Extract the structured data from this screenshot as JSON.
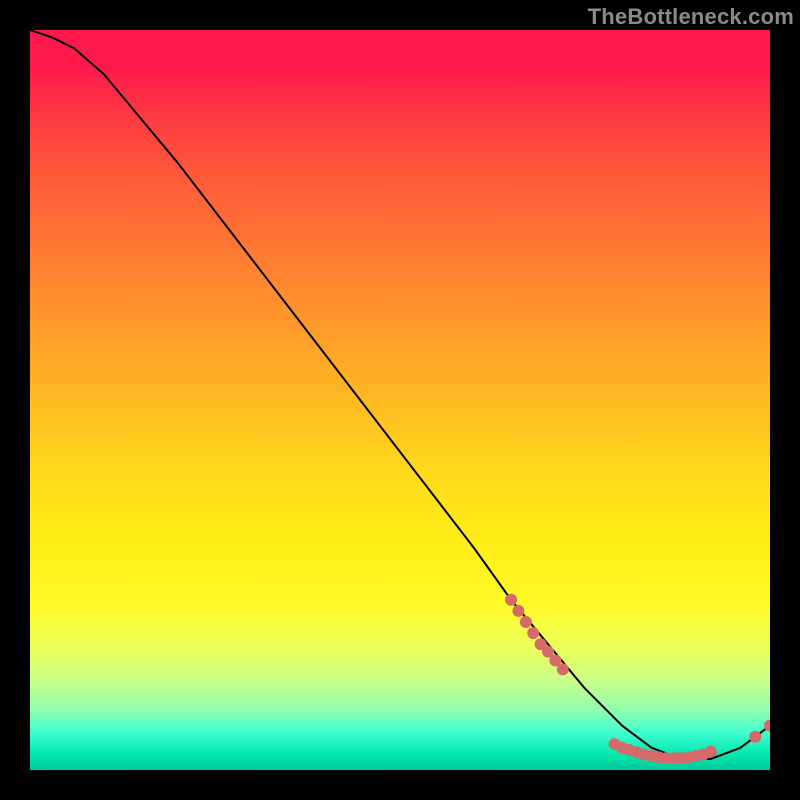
{
  "watermark": "TheBottleneck.com",
  "chart_data": {
    "type": "line",
    "title": "",
    "xlabel": "",
    "ylabel": "",
    "xlim": [
      0,
      100
    ],
    "ylim": [
      0,
      100
    ],
    "grid": false,
    "legend": false,
    "series": [
      {
        "name": "curve",
        "x": [
          0,
          3,
          6,
          10,
          20,
          30,
          40,
          50,
          60,
          65,
          70,
          75,
          80,
          84,
          88,
          92,
          96,
          100
        ],
        "y": [
          100,
          99,
          97.5,
          94,
          82,
          69,
          56,
          43,
          30,
          23,
          17,
          11,
          6,
          3,
          1.5,
          1.5,
          3,
          6
        ],
        "color": "#000000",
        "width": 2
      }
    ],
    "points": [
      {
        "name": "upper-cluster",
        "color": "#d66a6a",
        "r": 6,
        "xy": [
          [
            65,
            23
          ],
          [
            66,
            21.5
          ],
          [
            67,
            20
          ],
          [
            68,
            18.5
          ],
          [
            69,
            17
          ],
          [
            70,
            16
          ],
          [
            71,
            14.8
          ],
          [
            72,
            13.6
          ]
        ]
      },
      {
        "name": "bottom-cluster",
        "color": "#d66a6a",
        "r": 6,
        "xy": [
          [
            79,
            3.5
          ],
          [
            80,
            3
          ],
          [
            81,
            2.7
          ],
          [
            82,
            2.4
          ],
          [
            83,
            2.1
          ],
          [
            84,
            1.9
          ],
          [
            85,
            1.7
          ],
          [
            86,
            1.6
          ],
          [
            87,
            1.6
          ],
          [
            88,
            1.6
          ],
          [
            89,
            1.7
          ],
          [
            90,
            1.9
          ],
          [
            91,
            2.1
          ],
          [
            92,
            2.5
          ]
        ]
      },
      {
        "name": "right-tail",
        "color": "#d66a6a",
        "r": 6,
        "xy": [
          [
            98,
            4.5
          ],
          [
            100,
            6
          ]
        ]
      }
    ],
    "notes": "Axes are unlabeled; x and y are normalized 0-100 from plot edges. Values estimated from pixel positions."
  }
}
